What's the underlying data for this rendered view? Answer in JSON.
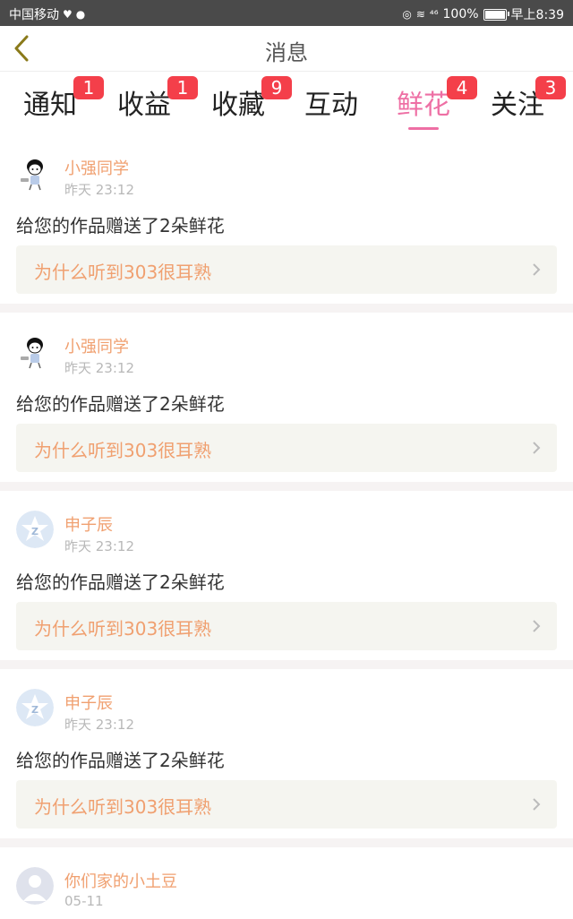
{
  "status_bar": {
    "carrier": "中国移动",
    "signal": "⁴⁶",
    "battery": "100%",
    "time": "早上8:39",
    "battery_level": 1.0
  },
  "header": {
    "title": "消息"
  },
  "tabs": [
    {
      "label": "通知",
      "badge": "1"
    },
    {
      "label": "收益",
      "badge": "1"
    },
    {
      "label": "收藏",
      "badge": "9"
    },
    {
      "label": "互动",
      "badge": ""
    },
    {
      "label": "鲜花",
      "badge": "4",
      "active": true
    },
    {
      "label": "关注",
      "badge": "3"
    }
  ],
  "messages": [
    {
      "user": "小强同学",
      "time": "昨天 23:12",
      "text": "给您的作品赠送了2朵鲜花",
      "work": "为什么听到303很耳熟",
      "avatar": "cartoon-boy-avatar"
    },
    {
      "user": "小强同学",
      "time": "昨天 23:12",
      "text": "给您的作品赠送了2朵鲜花",
      "work": "为什么听到303很耳熟",
      "avatar": "cartoon-boy-avatar"
    },
    {
      "user": "申子辰",
      "time": "昨天 23:12",
      "text": "给您的作品赠送了2朵鲜花",
      "work": "为什么听到303很耳熟",
      "avatar": "qzone-star-avatar"
    },
    {
      "user": "申子辰",
      "time": "昨天 23:12",
      "text": "给您的作品赠送了2朵鲜花",
      "work": "为什么听到303很耳熟",
      "avatar": "qzone-star-avatar"
    },
    {
      "user": "你们家的小土豆",
      "time": "05-11",
      "avatar": "default-person-avatar"
    }
  ],
  "colors": {
    "accent": "#ee6fa4",
    "badge": "#f43f4a",
    "username": "#f0a070",
    "status_bar": "#4a4a4a"
  }
}
